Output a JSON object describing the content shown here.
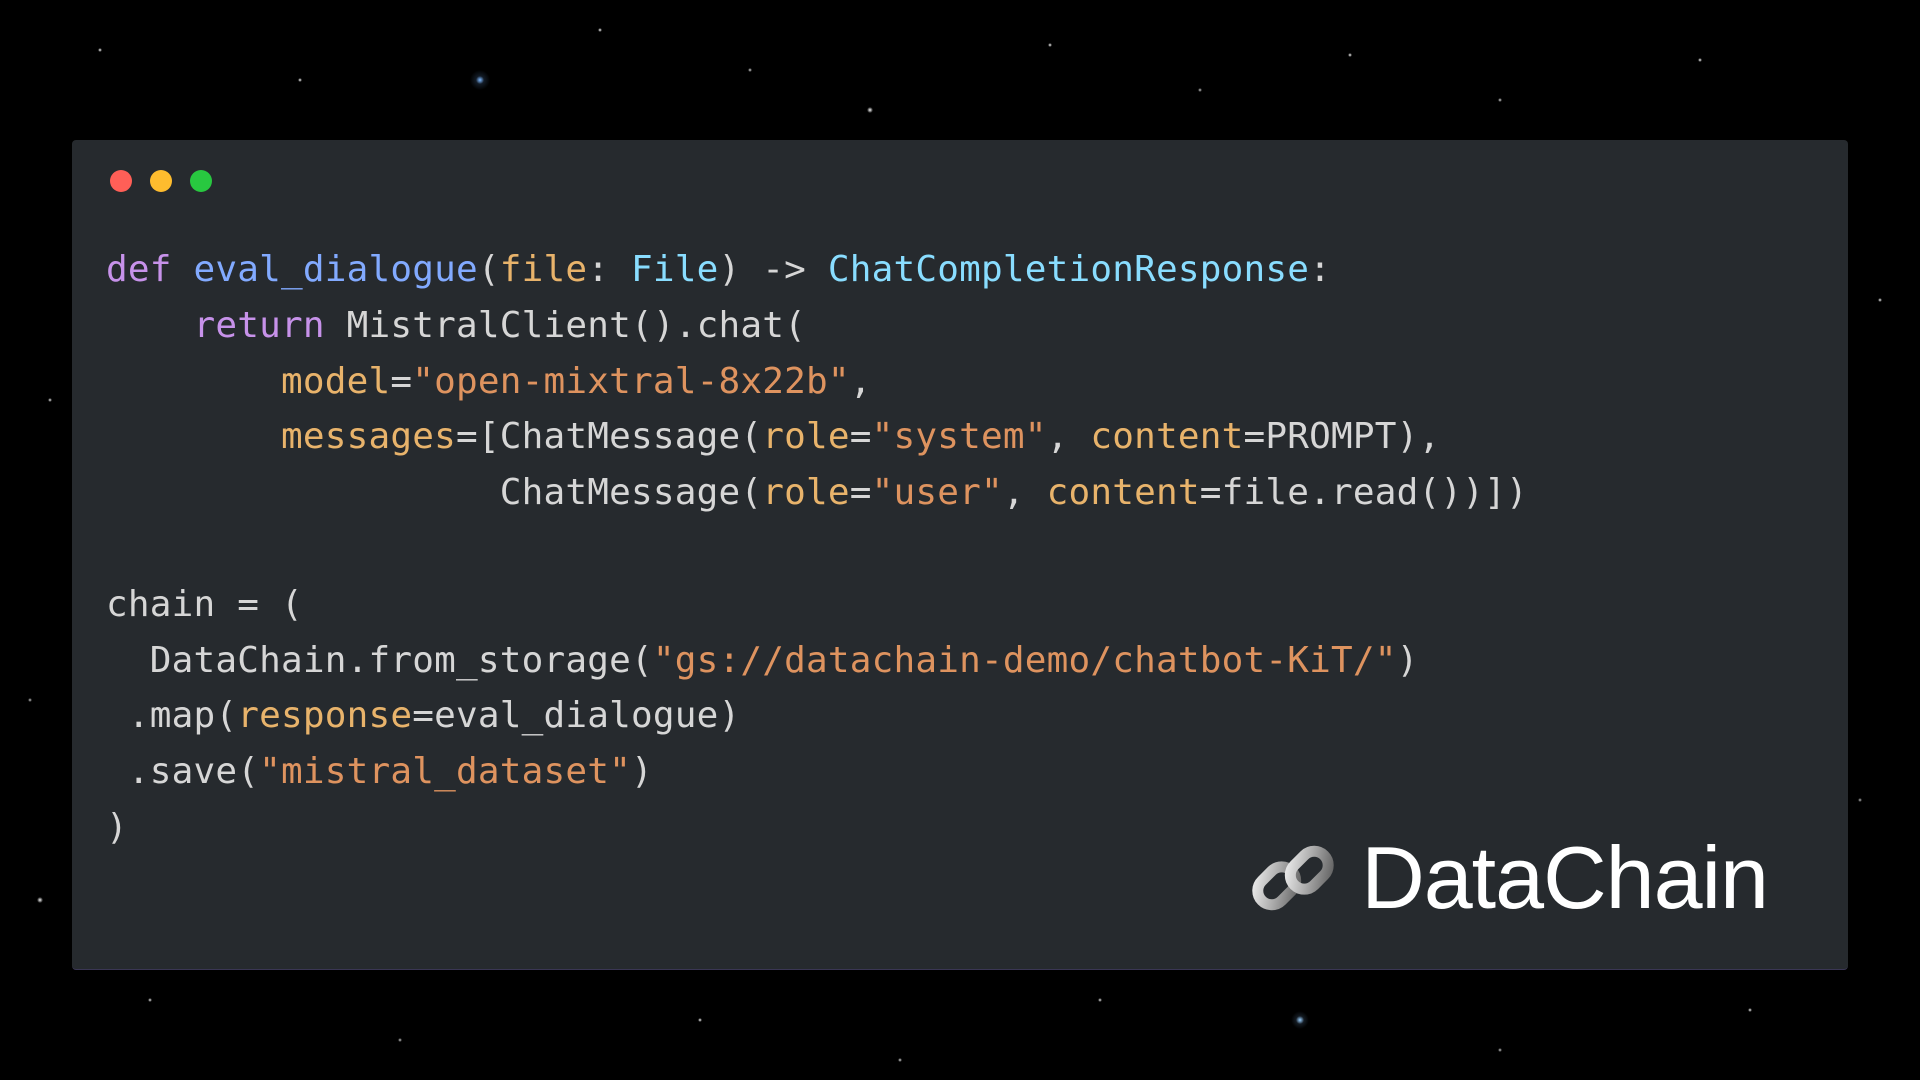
{
  "code": {
    "line1": {
      "def": "def",
      "func": "eval_dialogue",
      "open_paren": "(",
      "param_name": "file",
      "colon1": ": ",
      "param_type": "File",
      "close_paren_arrow": ") -> ",
      "return_type": "ChatCompletionResponse",
      "end_colon": ":"
    },
    "line2": {
      "indent": "    ",
      "return_kw": "return",
      "space": " ",
      "mistral": "MistralClient",
      "paren": "().",
      "chat": "chat",
      "open": "("
    },
    "line3": {
      "indent": "        ",
      "model_param": "model",
      "eq": "=",
      "model_str": "\"open-mixtral-8x22b\"",
      "comma": ","
    },
    "line4": {
      "indent": "        ",
      "msgs_param": "messages",
      "eq": "=[",
      "chatmsg": "ChatMessage",
      "open": "(",
      "role_param": "role",
      "eq2": "=",
      "role_str": "\"system\"",
      "comma": ", ",
      "content_param": "content",
      "eq3": "=",
      "prompt": "PROMPT",
      "close": "),"
    },
    "line5": {
      "indent": "                  ",
      "chatmsg": "ChatMessage",
      "open": "(",
      "role_param": "role",
      "eq": "=",
      "role_str": "\"user\"",
      "comma": ", ",
      "content_param": "content",
      "eq2": "=",
      "file_read": "file.read",
      "close": "())])"
    },
    "blank": "",
    "line7": {
      "chain_var": "chain",
      "eq": " = ("
    },
    "line8": {
      "indent": "  ",
      "datachain": "DataChain",
      "dot": ".",
      "from_storage": "from_storage",
      "open": "(",
      "path_str": "\"gs://datachain-demo/chatbot-KiT/\"",
      "close": ")"
    },
    "line9": {
      "indent": " .",
      "map": "map",
      "open": "(",
      "resp_param": "response",
      "eq": "=",
      "eval": "eval_dialogue",
      "close": ")"
    },
    "line10": {
      "indent": " .",
      "save": "save",
      "open": "(",
      "ds_str": "\"mistral_dataset\"",
      "close": ")"
    },
    "line11": {
      "close": ")"
    }
  },
  "logo_text": "DataChain"
}
